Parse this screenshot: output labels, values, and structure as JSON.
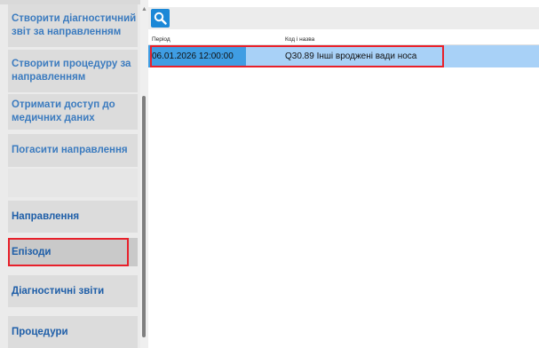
{
  "sidebar": {
    "items": [
      {
        "label": "Створити діагностичний звіт за направленням"
      },
      {
        "label": "Створити процедуру за направленням"
      },
      {
        "label": "Отримати доступ до медичних даних"
      },
      {
        "label": "Погасити направлення"
      },
      {
        "label": "Направлення"
      },
      {
        "label": "Епізоди"
      },
      {
        "label": "Діагностичні звіти"
      },
      {
        "label": "Процедури"
      }
    ]
  },
  "table": {
    "columns": [
      "Період",
      "Код і назва"
    ],
    "rows": [
      {
        "period": "06.01.2026 12:00:00",
        "code_name": "Q30.89 Інші вроджені вади носа"
      }
    ]
  },
  "colors": {
    "accent": "#1b88d7",
    "selected_row": "#a8d1f7",
    "highlight": "#e8202a",
    "sidebar_link": "#3b7bbf"
  }
}
